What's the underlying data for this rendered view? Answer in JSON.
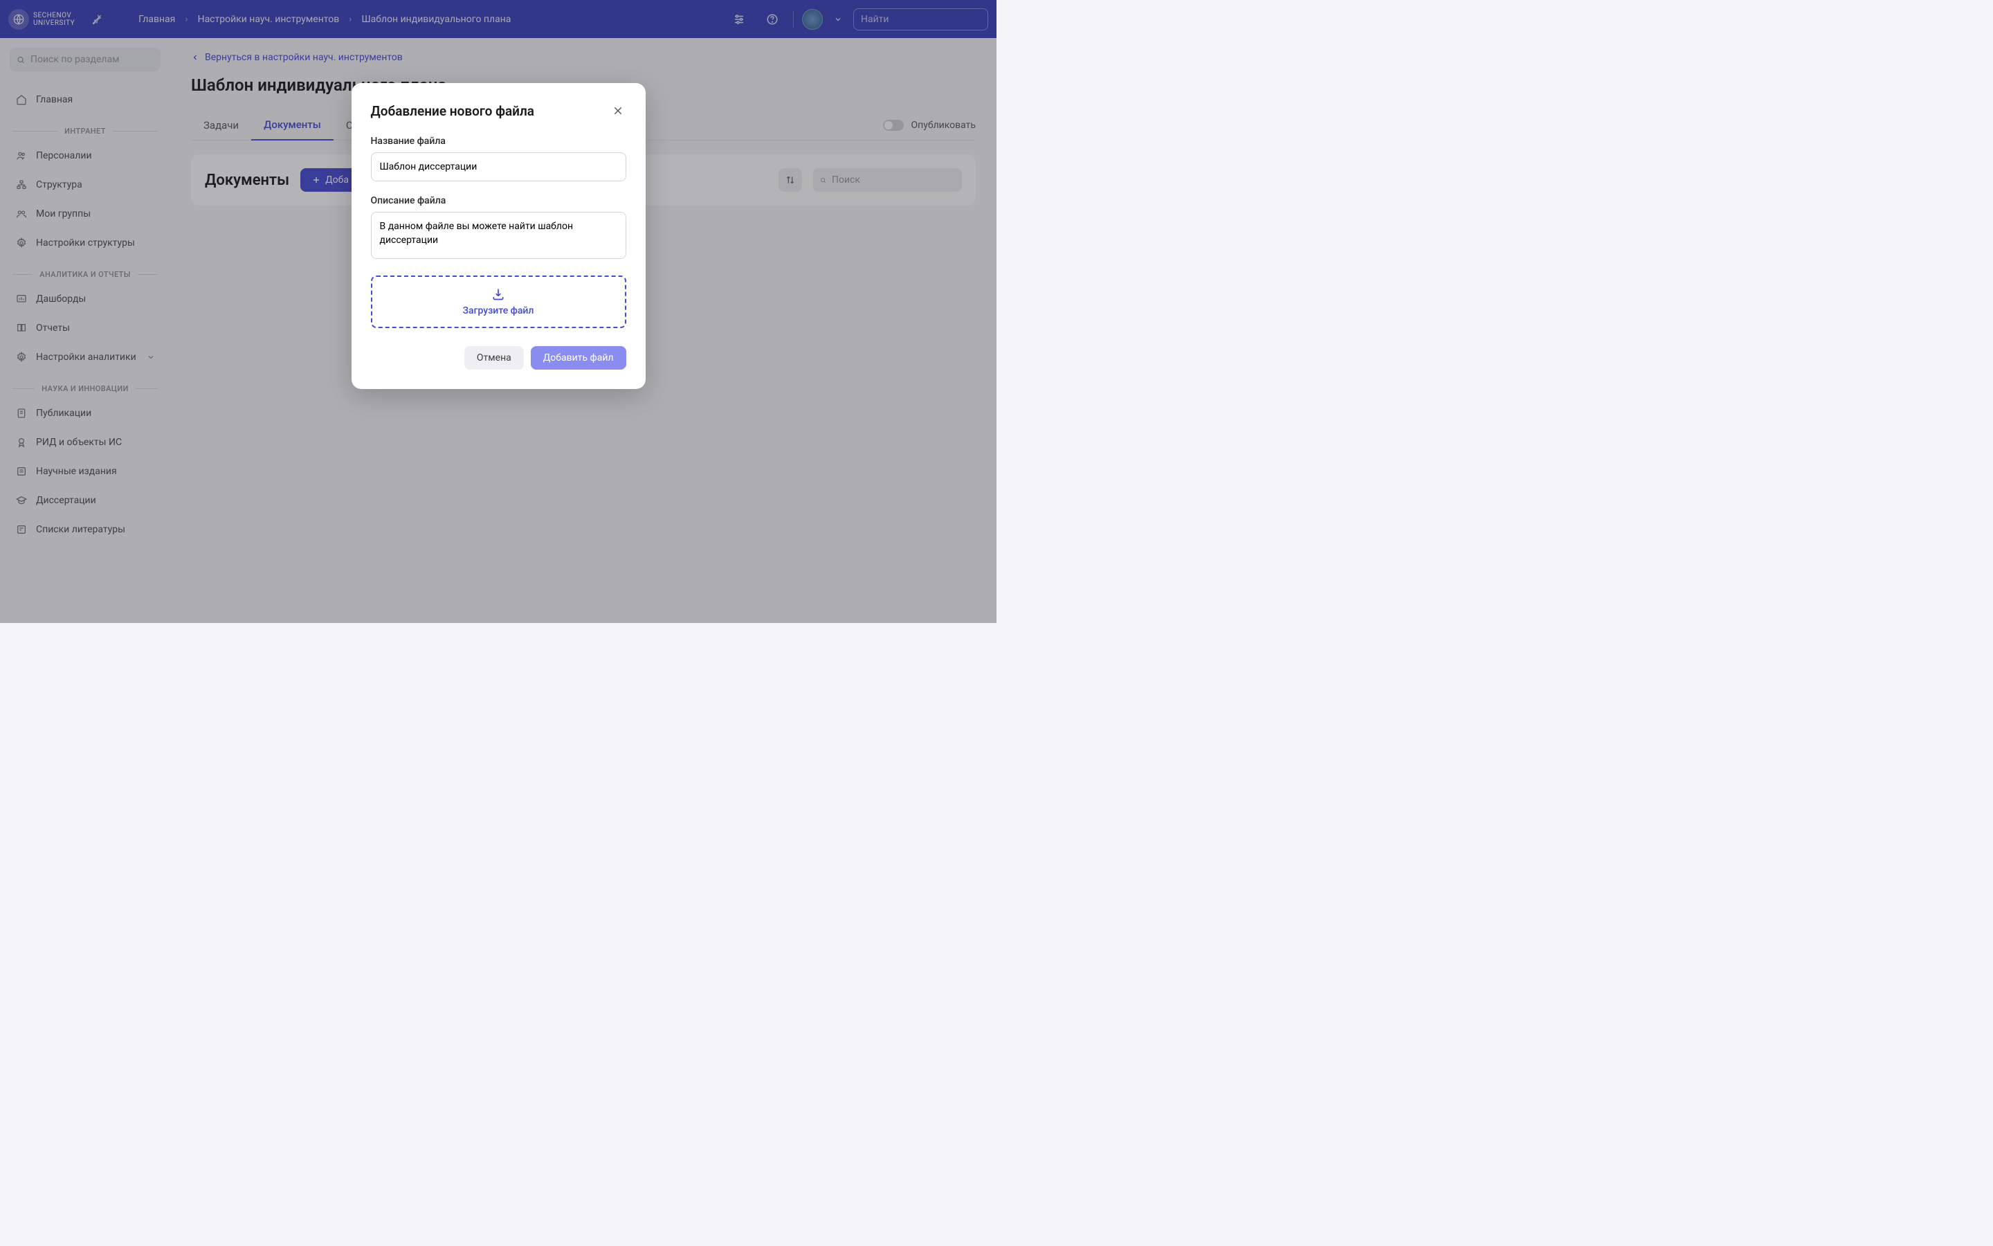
{
  "header": {
    "logo_top": "SECHENOV",
    "logo_bottom": "UNIVERSITY",
    "breadcrumb": [
      "Главная",
      "Настройки науч. инструментов",
      "Шаблон индивидуального плана"
    ],
    "search_placeholder": "Найти"
  },
  "sidebar": {
    "search_placeholder": "Поиск по разделам",
    "home": "Главная",
    "sections": [
      {
        "label": "ИНТРАНЕТ",
        "items": [
          "Персоналии",
          "Структура",
          "Мои группы",
          "Настройки структуры"
        ]
      },
      {
        "label": "АНАЛИТИКА И ОТЧЕТЫ",
        "items": [
          "Дашборды",
          "Отчеты",
          "Настройки аналитики"
        ],
        "expandable": [
          false,
          false,
          true
        ]
      },
      {
        "label": "НАУКА И ИННОВАЦИИ",
        "items": [
          "Публикации",
          "РИД и объекты ИС",
          "Научные издания",
          "Диссертации",
          "Списки литературы"
        ]
      }
    ]
  },
  "main": {
    "back_link": "Вернуться в настройки науч. инструментов",
    "title": "Шаблон индивидуального плана",
    "tabs": [
      "Задачи",
      "Документы",
      "С"
    ],
    "active_tab": 1,
    "publish_label": "Опубликовать",
    "card": {
      "title": "Документы",
      "add_button": "Доба",
      "search_placeholder": "Поиск"
    }
  },
  "modal": {
    "title": "Добавление нового файла",
    "name_label": "Название файла",
    "name_value": "Шаблон диссертации",
    "desc_label": "Описание файла",
    "desc_value": "В данном файле вы можете найти шаблон диссертации",
    "upload_label": "Загрузите файл",
    "cancel": "Отмена",
    "submit": "Добавить файл"
  }
}
